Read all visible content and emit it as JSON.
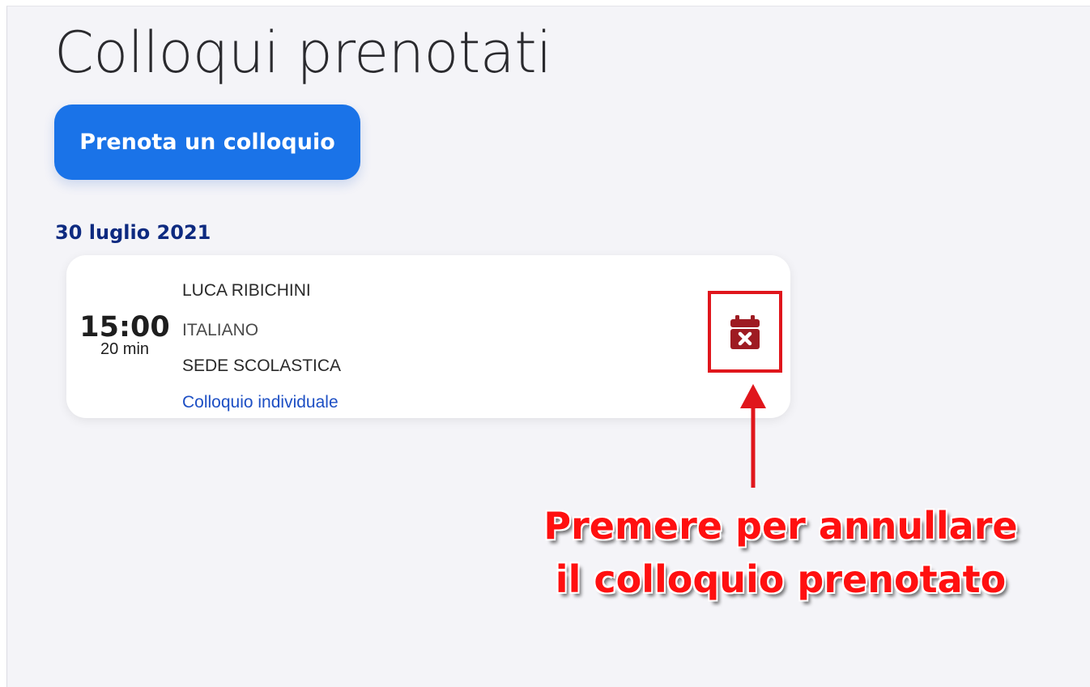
{
  "page": {
    "title": "Colloqui prenotati",
    "book_button_label": "Prenota un colloquio"
  },
  "appointments": [
    {
      "date": "30 luglio 2021",
      "time": "15:00",
      "duration": "20 min",
      "teacher": "LUCA RIBICHINI",
      "subject": "ITALIANO",
      "location": "SEDE SCOLASTICA",
      "meeting_type": "Colloquio individuale",
      "cancel_icon": "calendar-x-icon"
    }
  ],
  "annotation": {
    "line1": "Premere per annullare",
    "line2": "il colloquio prenotato"
  },
  "colors": {
    "button": "#1a73e8",
    "date_heading": "#0d2a80",
    "meeting_type_link": "#1d4fc4",
    "cancel_icon": "#9e1b22",
    "highlight": "#e0161c"
  }
}
